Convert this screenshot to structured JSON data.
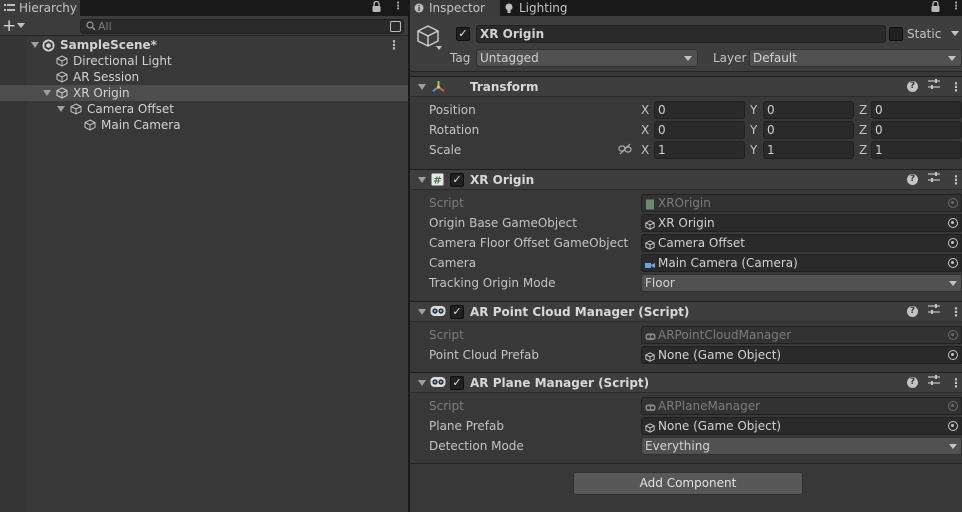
{
  "hierarchy": {
    "tab_label": "Hierarchy",
    "search_placeholder": "All",
    "scene": "SampleScene*",
    "items": [
      {
        "label": "Directional Light"
      },
      {
        "label": "AR Session"
      },
      {
        "label": "XR Origin"
      },
      {
        "label": "Camera Offset"
      },
      {
        "label": "Main Camera"
      }
    ],
    "selected": "XR Origin"
  },
  "inspector": {
    "tabs": [
      {
        "label": "Inspector"
      },
      {
        "label": "Lighting"
      }
    ],
    "object": {
      "name": "XR Origin",
      "static_label": "Static",
      "tag_label": "Tag",
      "tag_value": "Untagged",
      "layer_label": "Layer",
      "layer_value": "Default"
    },
    "transform": {
      "title": "Transform",
      "rows": [
        {
          "label": "Position",
          "x": "0",
          "y": "0",
          "z": "0"
        },
        {
          "label": "Rotation",
          "x": "0",
          "y": "0",
          "z": "0"
        },
        {
          "label": "Scale",
          "x": "1",
          "y": "1",
          "z": "1"
        }
      ],
      "axis_x": "X",
      "axis_y": "Y",
      "axis_z": "Z"
    },
    "xr_origin": {
      "title": "XR Origin",
      "script_label": "Script",
      "script_value": "XROrigin",
      "origin_label": "Origin Base GameObject",
      "origin_value": "XR Origin",
      "offset_label": "Camera Floor Offset GameObject",
      "offset_value": "Camera Offset",
      "camera_label": "Camera",
      "camera_value": "Main Camera (Camera)",
      "mode_label": "Tracking Origin Mode",
      "mode_value": "Floor"
    },
    "point_cloud": {
      "title": "AR Point Cloud Manager (Script)",
      "script_label": "Script",
      "script_value": "ARPointCloudManager",
      "prefab_label": "Point Cloud Prefab",
      "prefab_value": "None (Game Object)"
    },
    "plane": {
      "title": "AR Plane Manager (Script)",
      "script_label": "Script",
      "script_value": "ARPlaneManager",
      "prefab_label": "Plane Prefab",
      "prefab_value": "None (Game Object)",
      "mode_label": "Detection Mode",
      "mode_value": "Everything"
    },
    "add_component": "Add Component"
  },
  "icons": {
    "hierarchy_tab": "list-icon",
    "inspector_tab": "info-icon",
    "lighting_tab": "bulb-icon",
    "lock": "lock-icon",
    "menu": "kebab-icon",
    "gameobject": "cube-icon",
    "transform": "axes-icon",
    "script": "hash-icon",
    "ar_component": "ar-headset-icon",
    "help": "help-icon",
    "preset": "sliders-icon",
    "link": "link-icon",
    "picker": "target-icon",
    "camera": "camera-icon"
  },
  "colors": {
    "panel_bg": "#383838",
    "header_bg": "#3e3e3e",
    "field_bg": "#2a2a2a",
    "selection": "#4d4d4d",
    "text": "#c4c4c4"
  }
}
